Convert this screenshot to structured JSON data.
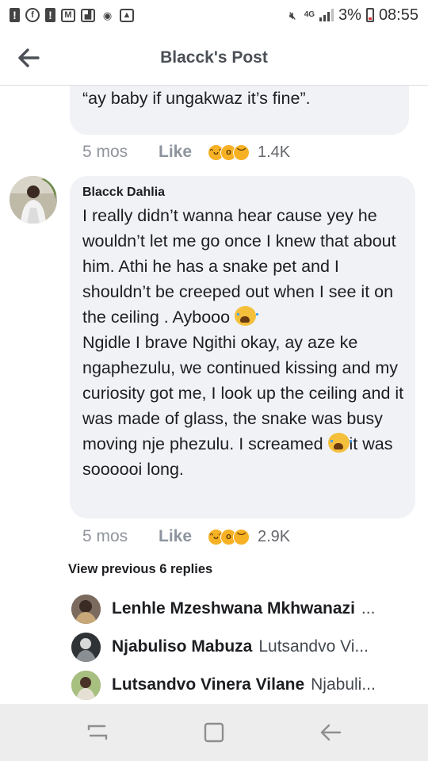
{
  "status_bar": {
    "network": "4G",
    "battery_percent": "3%",
    "time": "08:55"
  },
  "header": {
    "title": "Blacck's Post"
  },
  "comments": [
    {
      "text": "down,I was scared as hell. He then said “ay baby if ungakwaz it’s fine”.",
      "time": "5 mos",
      "like_label": "Like",
      "reaction_count": "1.4K"
    },
    {
      "author": "Blacck Dahlia",
      "text_part1": "I really didn’t wanna hear cause yey he wouldn’t let me go once I knew that about him. Athi he has a snake pet and I shouldn’t be creeped out when I see it on the ceiling . Aybooo ",
      "text_part2": "\nNgidle I brave Ngithi okay, ay aze ke ngaphezulu, we continued kissing and my curiosity got me, I look up the ceiling and it was made of glass, the snake was busy moving nje phezulu. I screamed ",
      "text_part3": "it was soooooi long.",
      "time": "5 mos",
      "like_label": "Like",
      "reaction_count": "2.9K"
    }
  ],
  "replies": {
    "view_previous_label": "View previous 6 replies",
    "items": [
      {
        "name": "Lenhle Mzeshwana Mkhwanazi",
        "snippet": "..."
      },
      {
        "name": "Njabuliso Mabuza",
        "snippet": "Lutsandvo Vi..."
      },
      {
        "name": "Lutsandvo Vinera Vilane",
        "snippet": "Njabuli..."
      }
    ]
  },
  "colors": {
    "bubble_bg": "#f0f2f5",
    "meta_text": "#90949c",
    "reaction_yellow": "#f7b125",
    "navbar_bg": "#ededed"
  },
  "icons": {
    "back": "back-arrow-icon",
    "nav_recent": "recent-apps-icon",
    "nav_home": "home-icon",
    "nav_back": "back-icon"
  }
}
